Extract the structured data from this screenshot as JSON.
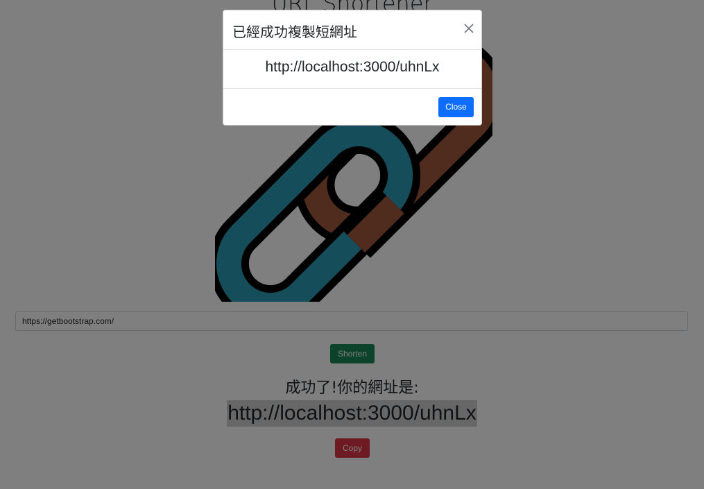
{
  "page": {
    "title": "URL Shortener",
    "input_value": "https://getbootstrap.com/",
    "shorten_label": "Shorten",
    "result_label": "成功了!你的網址是:",
    "result_url": "http://localhost:3000/uhnLx",
    "copy_label": "Copy"
  },
  "modal": {
    "title": "已經成功複製短網址",
    "body": "http://localhost:3000/uhnLx",
    "close_label": "Close"
  },
  "icons": {
    "logo": "chain-link-icon",
    "close": "close-icon"
  },
  "colors": {
    "primary": "#0d6efd",
    "success": "#198754",
    "danger": "#dc3545",
    "link_teal": "#2a9ab5",
    "link_rust": "#a0583f",
    "backdrop": "rgba(0,0,0,0.5)"
  }
}
